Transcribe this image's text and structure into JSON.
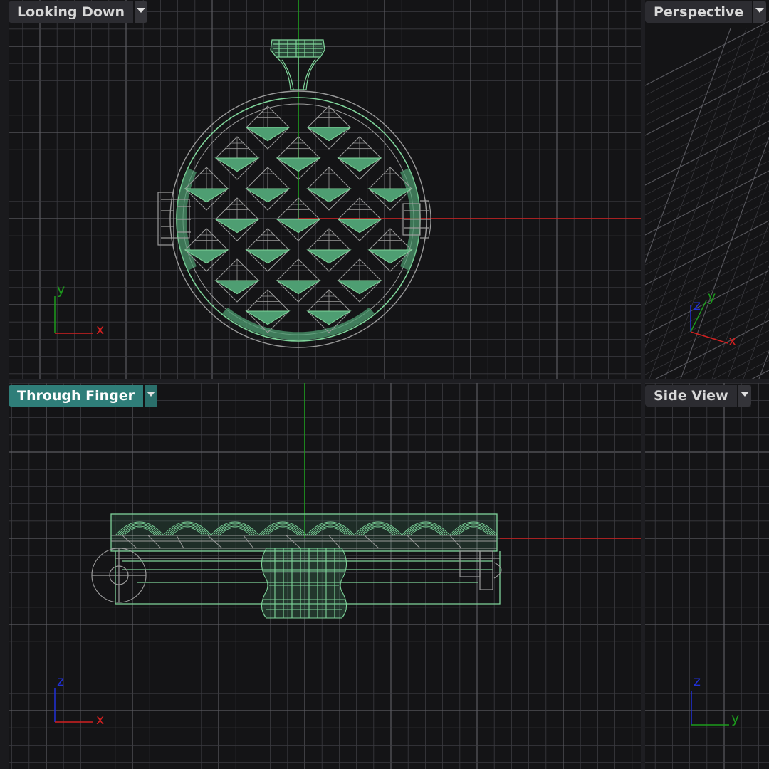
{
  "viewports": {
    "top": {
      "title": "Looking Down",
      "axis_h": "x",
      "axis_v": "y"
    },
    "perspective": {
      "title": "Perspective",
      "axis_x": "x",
      "axis_y": "y",
      "axis_z": "z"
    },
    "front": {
      "title": "Through Finger",
      "axis_h": "x",
      "axis_v": "z",
      "active": true
    },
    "side": {
      "title": "Side View",
      "axis_h": "y",
      "axis_v": "z"
    }
  },
  "colors": {
    "background": "#141416",
    "grid_minor": "#3b3b40",
    "grid_major": "#5a5a60",
    "axis_x": "#d22020",
    "axis_y": "#1c9c1c",
    "axis_z": "#2030d8",
    "wire_green": "#7fd49a",
    "fill_green": "#4e9e72",
    "wire_grey": "#9a9a9a",
    "active_tab": "#2f7e79"
  },
  "icons": [
    "dropdown-arrow-icon"
  ]
}
